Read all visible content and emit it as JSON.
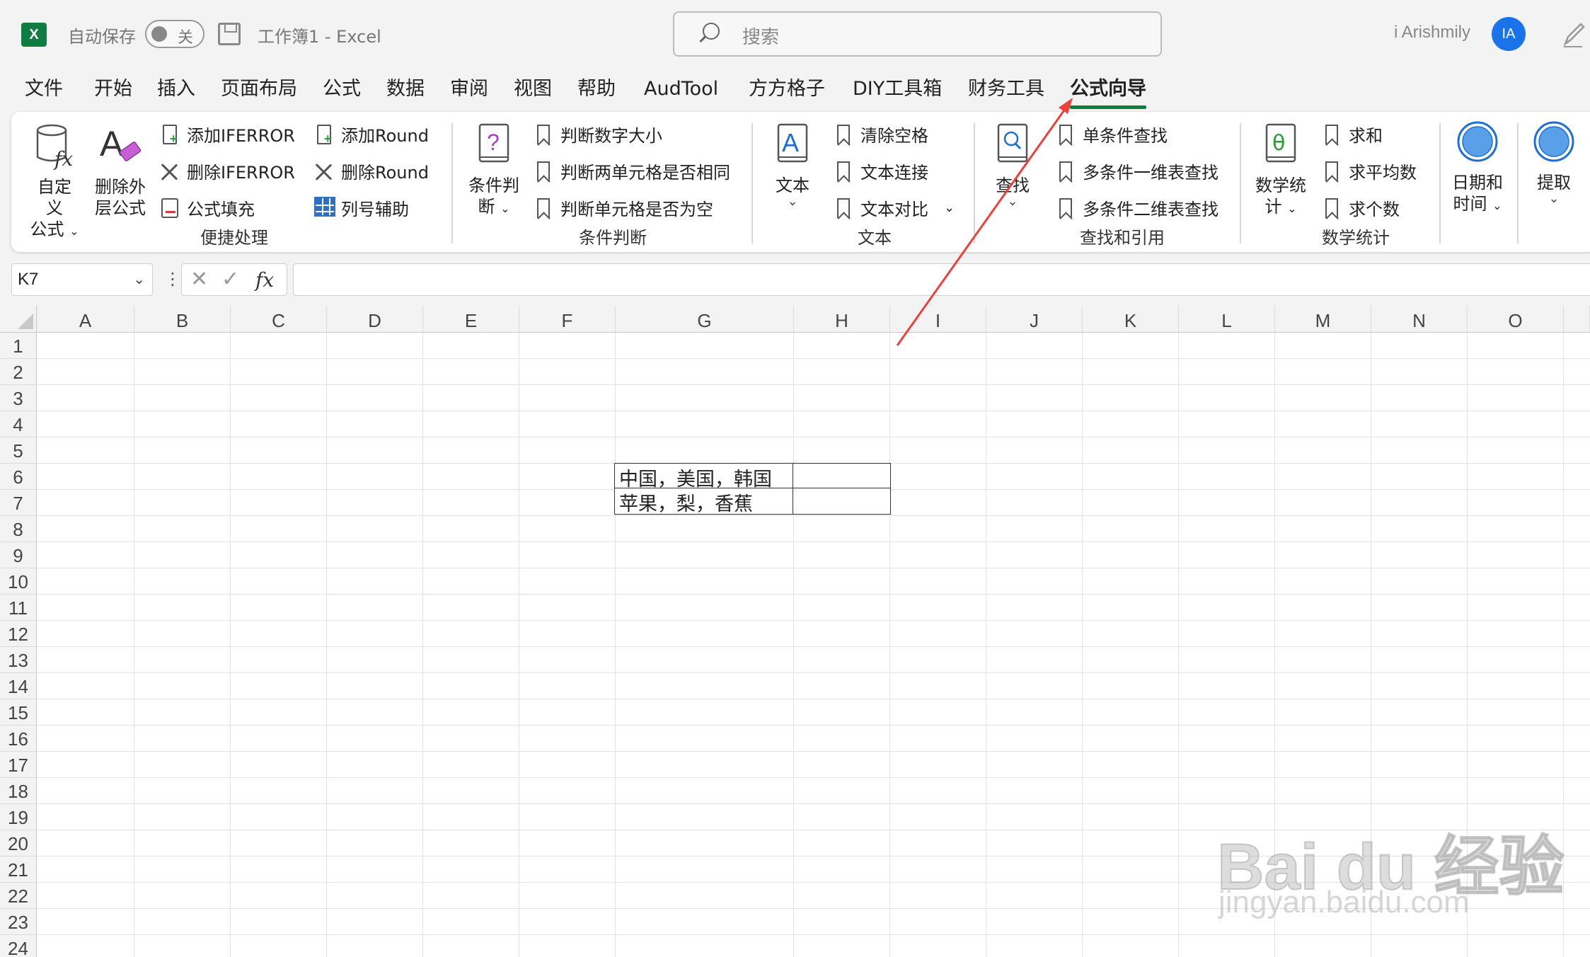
{
  "titlebar": {
    "app_letter": "X",
    "autosave_label": "自动保存",
    "autosave_state": "关",
    "doc_title": "工作簿1  -  Excel",
    "search_placeholder": "搜索",
    "user_name": "i Arishmily",
    "user_initials": "IA"
  },
  "menu": {
    "tabs": [
      "文件",
      "开始",
      "插入",
      "页面布局",
      "公式",
      "数据",
      "审阅",
      "视图",
      "帮助",
      "AudTool",
      "方方格子",
      "DIY工具箱",
      "财务工具",
      "公式向导"
    ],
    "active_tab": "公式向导"
  },
  "ribbon": {
    "groups": {
      "quick": {
        "label": "便捷处理",
        "custom_formula": [
          "自定义",
          "公式"
        ],
        "remove_outer": [
          "删除外",
          "层公式"
        ],
        "add_iferror": "添加IFERROR",
        "remove_iferror": "删除IFERROR",
        "formula_fill": "公式填充",
        "add_round": "添加Round",
        "remove_round": "删除Round",
        "column_helper": "列号辅助"
      },
      "condition": {
        "label": "条件判断",
        "main": [
          "条件判",
          "断"
        ],
        "items": [
          "判断数字大小",
          "判断两单元格是否相同",
          "判断单元格是否为空"
        ]
      },
      "text": {
        "label": "文本",
        "main": "文本",
        "items": [
          "清除空格",
          "文本连接",
          "文本对比"
        ]
      },
      "lookup": {
        "label": "查找和引用",
        "main": "查找",
        "items": [
          "单条件查找",
          "多条件一维表查找",
          "多条件二维表查找"
        ]
      },
      "math": {
        "label": "数学统计",
        "main": [
          "数学统",
          "计"
        ],
        "items": [
          "求和",
          "求平均数",
          "求个数"
        ]
      },
      "date": {
        "main": [
          "日期和",
          "时间"
        ]
      },
      "extract": {
        "main": "提取"
      }
    }
  },
  "formula_bar": {
    "name_box": "K7",
    "fx": "fx",
    "value": ""
  },
  "sheet": {
    "columns": [
      "A",
      "B",
      "C",
      "D",
      "E",
      "F",
      "G",
      "H",
      "I",
      "J",
      "K",
      "L",
      "M",
      "N",
      "O"
    ],
    "rows": [
      "1",
      "2",
      "3",
      "4",
      "5",
      "6",
      "7",
      "8",
      "9",
      "10",
      "11",
      "12",
      "13",
      "14",
      "15",
      "16",
      "17",
      "18",
      "19",
      "20",
      "21",
      "22",
      "23",
      "24"
    ],
    "cells": {
      "G6": "中国，美国，韩国",
      "H6": "",
      "G7": "苹果，梨，香蕉",
      "H7": ""
    }
  },
  "watermark": {
    "brand": "Bai du 经验",
    "url": "jingyan.baidu.com"
  },
  "colors": {
    "excel_green": "#107c41",
    "avatar_blue": "#1a73e8",
    "annotation_arrow": "#e8423c"
  },
  "icons": [
    "excel-logo-icon",
    "save-icon",
    "search-icon",
    "pen-icon",
    "bookmark-icon",
    "close-x-icon",
    "document-add-icon",
    "grid-icon",
    "fx-icon",
    "question-book-icon",
    "letter-a-book-icon",
    "magnifier-book-icon",
    "theta-book-icon",
    "circle-icon",
    "chevron-down-icon"
  ]
}
